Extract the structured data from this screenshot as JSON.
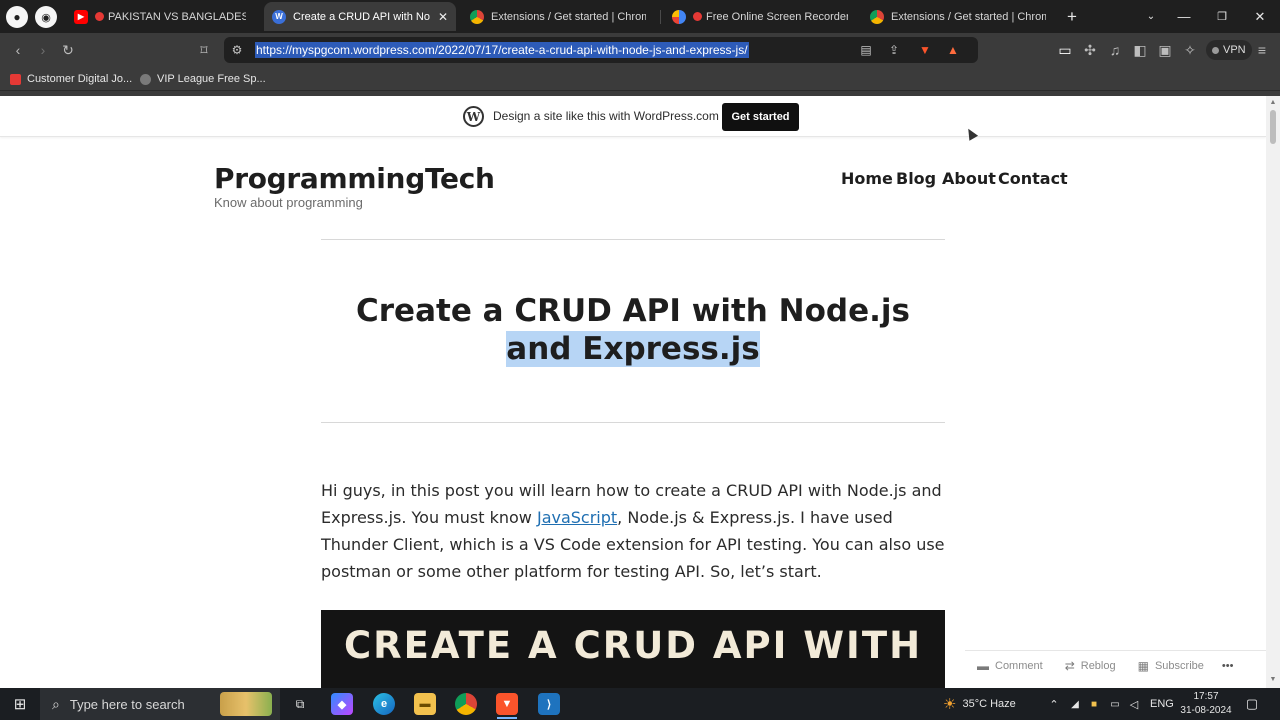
{
  "colors": {
    "browser_bg": "#1f1f1f",
    "toolbar_bg": "#3b3b3b",
    "url_highlight": "#2d5bb8",
    "wp_button": "#101010",
    "link": "#1f6fb2",
    "selection": "#b7d5f5"
  },
  "browser": {
    "tabs": [
      {
        "title": "PAKISTAN VS BANGLADESH: BA",
        "icon": "youtube-icon"
      },
      {
        "title": "Create a CRUD API with Node.js",
        "icon": "wordpress-icon"
      },
      {
        "title": "Extensions / Get started | Chrome",
        "icon": "chrome-icon"
      },
      {
        "title": "Free Online Screen Recorder",
        "icon": "screen-recorder-icon"
      },
      {
        "title": "Extensions / Get started | Chrome",
        "icon": "chrome-icon"
      }
    ],
    "url": "https://myspgcom.wordpress.com/2022/07/17/create-a-crud-api-with-node-js-and-express-js/",
    "vpn_label": "VPN",
    "bookmarks": [
      {
        "label": "Customer Digital Jo...",
        "icon": "bookmark-favicon"
      },
      {
        "label": "VIP League Free Sp...",
        "icon": "bookmark-favicon"
      }
    ]
  },
  "wp_banner": {
    "text": "Design a site like this with WordPress.com",
    "button": "Get started"
  },
  "site": {
    "title": "ProgrammingTech",
    "tagline": "Know about programming",
    "nav": [
      "Home",
      "Blog",
      "About",
      "Contact"
    ]
  },
  "post": {
    "title_line1": "Create a CRUD API with Node.js",
    "title_line2": "and Express.js",
    "body_before_link": "Hi guys, in this post you will learn how to create a CRUD API with Node.js and Express.js. You must know ",
    "body_link": "JavaScript",
    "body_after_link": ", Node.js & Express.js. I have used Thunder Client, which is a VS Code extension for API testing. You can also use postman or some other platform for testing API. So, let’s start.",
    "banner_text": "CREATE A CRUD API WITH"
  },
  "actions": {
    "comment": "Comment",
    "reblog": "Reblog",
    "subscribe": "Subscribe",
    "more": "•••"
  },
  "taskbar": {
    "search_placeholder": "Type here to search",
    "weather": "35°C  Haze",
    "lang": "ENG",
    "time": "17:57",
    "date": "31-08-2024"
  }
}
